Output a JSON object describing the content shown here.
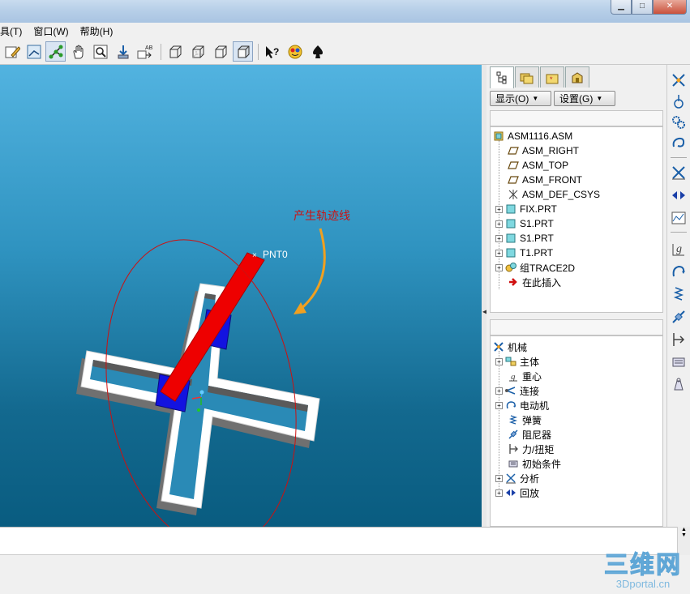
{
  "window": {
    "controls": {
      "minimize": "▁",
      "maximize": "□",
      "close": "✕"
    }
  },
  "menubar": [
    "具(T)",
    "窗口(W)",
    "帮助(H)"
  ],
  "viewport": {
    "annotation": "产生轨迹线",
    "point_label": "PNT0"
  },
  "model_panel": {
    "show_dropdown": "显示(O)",
    "settings_dropdown": "设置(G)",
    "tree": [
      {
        "label": "ASM1116.ASM",
        "icon": "assembly-icon"
      },
      {
        "label": "ASM_RIGHT",
        "icon": "datum-plane-icon"
      },
      {
        "label": "ASM_TOP",
        "icon": "datum-plane-icon"
      },
      {
        "label": "ASM_FRONT",
        "icon": "datum-plane-icon"
      },
      {
        "label": "ASM_DEF_CSYS",
        "icon": "csys-icon"
      },
      {
        "label": "FIX.PRT",
        "icon": "part-icon"
      },
      {
        "label": "S1.PRT",
        "icon": "part-icon"
      },
      {
        "label": "S1.PRT",
        "icon": "part-icon"
      },
      {
        "label": "T1.PRT",
        "icon": "part-icon"
      },
      {
        "label": "组TRACE2D",
        "icon": "group-icon"
      },
      {
        "label": "在此插入",
        "icon": "insert-here-arrow-icon"
      }
    ],
    "mech_tree": [
      {
        "label": "机械",
        "icon": "mechanism-icon"
      },
      {
        "label": "主体",
        "icon": "body-icon"
      },
      {
        "label": "重心",
        "icon": "gravity-icon"
      },
      {
        "label": "连接",
        "icon": "connection-icon"
      },
      {
        "label": "电动机",
        "icon": "motor-icon"
      },
      {
        "label": "弹簧",
        "icon": "spring-icon"
      },
      {
        "label": "阻尼器",
        "icon": "damper-icon"
      },
      {
        "label": "力/扭矩",
        "icon": "force-torque-icon"
      },
      {
        "label": "初始条件",
        "icon": "initial-condition-icon"
      },
      {
        "label": "分析",
        "icon": "analysis-icon"
      },
      {
        "label": "回放",
        "icon": "playback-icon"
      }
    ]
  },
  "watermark": {
    "main": "三维网",
    "sub": "3Dportal.cn"
  },
  "colors": {
    "annotation_red": "#cc1111",
    "arrow_orange": "#f0a020",
    "bar_red": "#ee0000"
  }
}
